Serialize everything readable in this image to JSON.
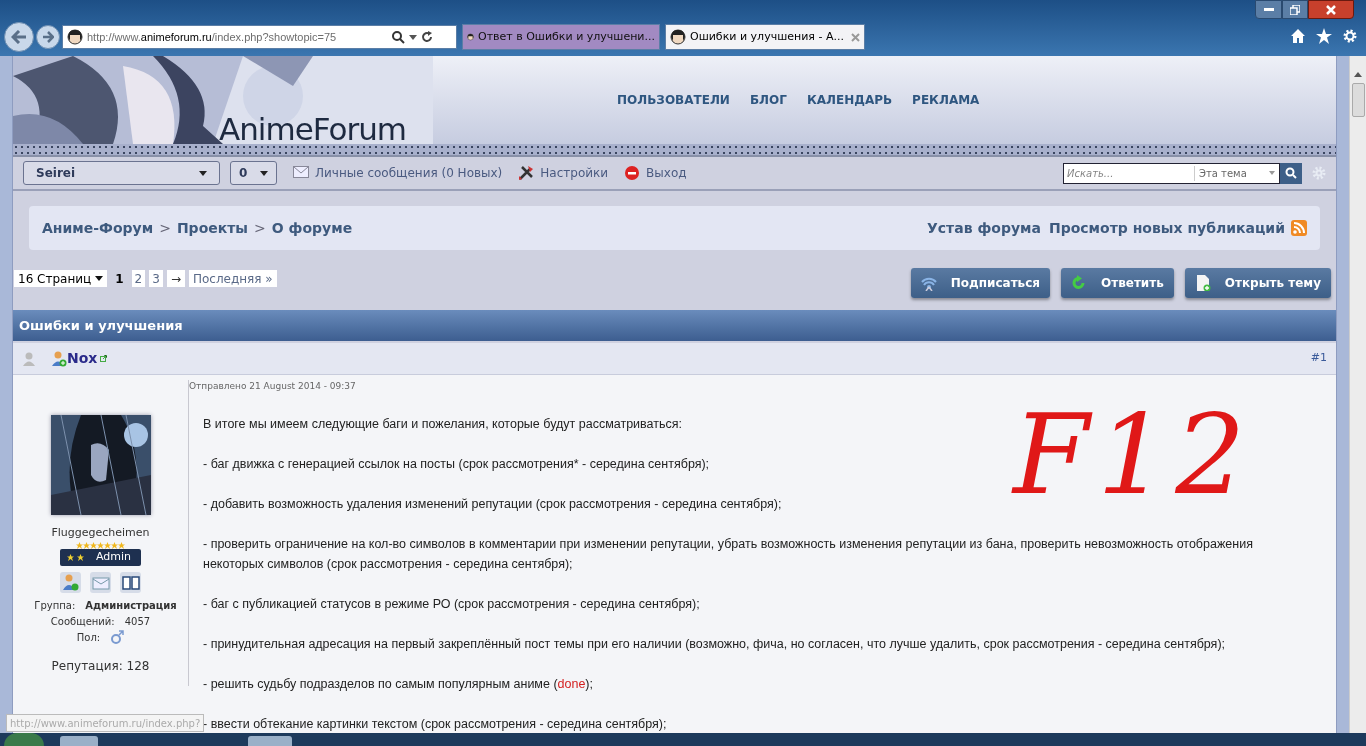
{
  "browser": {
    "url": "http://www.**animeforum.ru**/index.php?showtopic=75",
    "tabs": [
      {
        "title": "Ответ в Ошибки и улучшени...",
        "selected": false
      },
      {
        "title": "Ошибки и улучшения - А...",
        "selected": true
      }
    ]
  },
  "header": {
    "logo": "AnimeForum",
    "nav": [
      "ПОЛЬЗОВАТЕЛИ",
      "БЛОГ",
      "КАЛЕНДАРЬ",
      "РЕКЛАМА"
    ]
  },
  "userbar": {
    "user": "Seirei",
    "count": "0",
    "links": [
      {
        "kind": "mail",
        "label": "Личные сообщения (0 Новых)"
      },
      {
        "kind": "tools",
        "label": "Настройки"
      },
      {
        "kind": "exit",
        "label": "Выход"
      }
    ],
    "search": {
      "placeholder": "Искать...",
      "scope": "Эта тема"
    }
  },
  "breadcrumb": [
    "Аниме-Форум",
    "Проекты",
    "О форуме"
  ],
  "breadcrumb_separator": ">",
  "breadcrumb_links": [
    "Устав форума",
    "Просмотр новых публикаций"
  ],
  "pagination": {
    "pages_label": "16 Страниц",
    "pages": [
      {
        "label": "1",
        "selected": true
      },
      {
        "label": "2",
        "selected": false
      },
      {
        "label": "3",
        "selected": false
      }
    ],
    "next": "→",
    "last": "Последняя »"
  },
  "actions": [
    {
      "kind": "subscribe",
      "label": "Подписаться"
    },
    {
      "kind": "reply",
      "label": "Ответить"
    },
    {
      "kind": "new",
      "label": "Открыть тему"
    }
  ],
  "topic_title": "Ошибки и улучшения",
  "post": {
    "author": "Nox",
    "number": "#1",
    "date": "Отправлено 21 August 2014 - 09:37",
    "profile": {
      "name": "Fluggegecheimen",
      "rank": "Admin",
      "group_label": "Группа:",
      "group": "Администрация",
      "posts_label": "Сообщений:",
      "posts": "4057",
      "gender_label": "Пол:",
      "reputation": "Репутация: 128"
    },
    "paragraphs": [
      [
        {
          "text": "В итоге мы имеем следующие баги и пожелания, которые будут рассматриваться:"
        }
      ],
      [
        {
          "text": "- баг движка с генерацией ссылок на посты (срок рассмотрения* - середина сентября);"
        }
      ],
      [
        {
          "text": "- добавить возможность удаления изменений репутации (срок рассмотрения - середина сентября);"
        }
      ],
      [
        {
          "text": "- проверить ограничение на кол-во символов в комментарии при изменении репутации, убрать возможность изменения репутации из бана, проверить невозможность отображения некоторых символов (срок рассмотрения - середина сентября);"
        }
      ],
      [
        {
          "text": "- баг с публикацией статусов в режиме РО (срок рассмотрения - середина сентября);"
        }
      ],
      [
        {
          "text": "- принудительная адресация на первый закреплённый пост темы при его наличии (возможно, фича, но согласен, что лучше удалить, срок рассмотрения - середина сентября);"
        }
      ],
      [
        {
          "text": "- решить судьбу подразделов по самым популярным аниме ("
        },
        {
          "text": "done",
          "kind": "status"
        },
        {
          "text": ");"
        }
      ],
      [
        {
          "text": "- ввести обтекание картинки текстом (срок рассмотрения - середина сентября);"
        }
      ]
    ]
  },
  "annotation": "F12",
  "status_url": "http://www.animeforum.ru/index.php?"
}
